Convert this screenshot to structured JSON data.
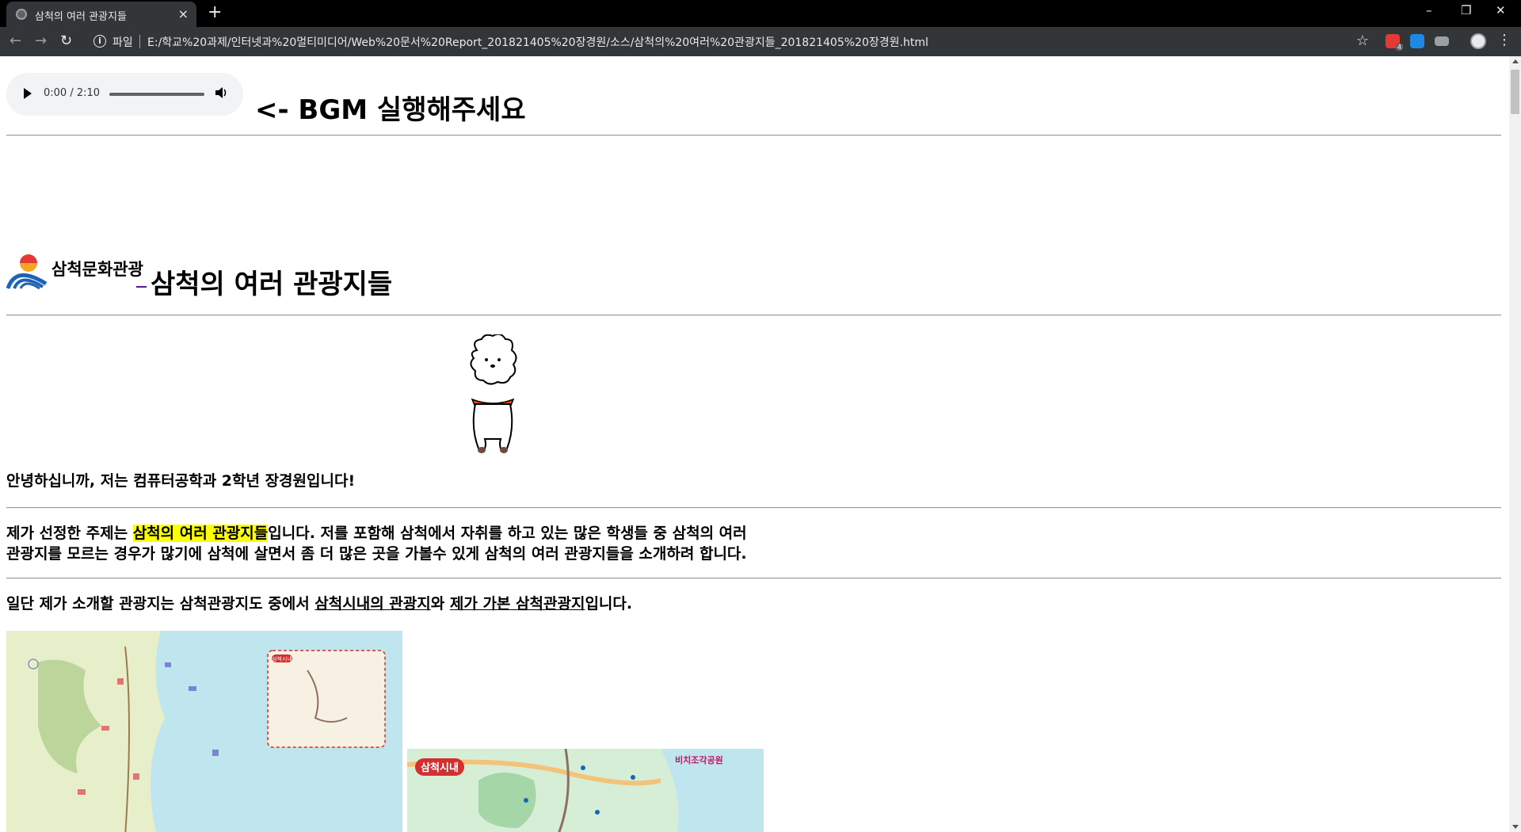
{
  "browser": {
    "tab_title": "삼척의 여러 관광지들",
    "new_tab": "+",
    "close_tab": "×",
    "window_controls": {
      "minimize": "–",
      "restore": "❐",
      "close": "✕"
    },
    "omnibox": {
      "scheme_label": "파일",
      "url": "E:/학교%20과제/인터넷과%20멀티미디어/Web%20문서%20Report_201821405%20장경원/소스/삼척의%20여러%20관광지들_201821405%20장경원.html"
    },
    "nav": {
      "back": "←",
      "forward": "→",
      "reload": "↻"
    },
    "extensions": [
      {
        "name": "ext-red-icon",
        "badge": "4",
        "color": "#e53935"
      },
      {
        "name": "ext-blue-icon",
        "color": "#1e88e5"
      },
      {
        "name": "ext-gray-icon",
        "color": "#9aa0a6"
      }
    ],
    "menu": "⋮",
    "star": "☆"
  },
  "audio": {
    "time_display": "0:00 / 2:10",
    "progress": 0
  },
  "page": {
    "bgm_heading": "<- BGM 실행해주세요",
    "logo_text": "삼척문화관광",
    "title_heading": "삼척의 여러 관광지들",
    "greeting": "안녕하십니까, 저는 컴퓨터공학과 2학년 장경원입니다!",
    "intro": {
      "line1_before": "제가 선정한 주제는 ",
      "highlight": "삼척의 여러 관광지들",
      "line1_after": "입니다. 저를 포함해 삼척에서 자취를 하고 있는 많은 학생들 중 삼척의 여러",
      "line2": "관광지를 모르는 경우가 많기에 삼척에 살면서 좀 더 많은 곳을 가볼수 있게 삼척의 여러 관광지들을 소개하려 합니다."
    },
    "overview": {
      "before": "일단 제가 소개할 관광지는 삼척관광지도 중에서 ",
      "link1": "삼척시내의 관광지",
      "middle": "와 ",
      "link2": "제가 가본 삼척관광지",
      "after": "입니다."
    },
    "map1_labels": {
      "inset": "삼척시내"
    },
    "map2_labels": {
      "badge": "삼척시내",
      "park": "비치조각공원"
    },
    "colors": {
      "highlight": "#ffff00",
      "map_sea": "#bfe6ef",
      "map_land": "#d7eed6"
    }
  }
}
